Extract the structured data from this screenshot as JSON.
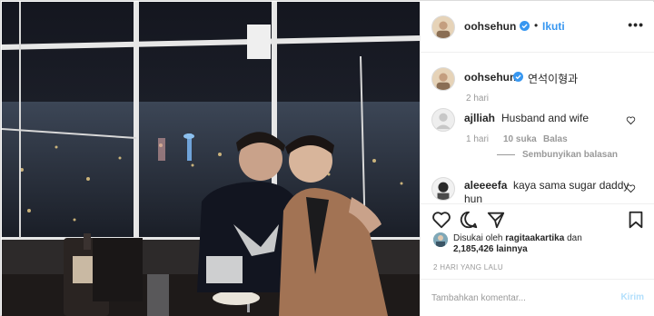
{
  "post": {
    "author": "oohsehun",
    "follow_label": "Ikuti",
    "separator": "•",
    "more_label": "•••",
    "photo_alt": "Two men sitting together at a restaurant table by a window at night with a city view"
  },
  "caption": {
    "user": "oohsehun",
    "text": "연석이형과",
    "time": "2 hari"
  },
  "comments": [
    {
      "user": "ajlliah",
      "text": "Husband and wife",
      "time": "1 hari",
      "likes": "10 suka",
      "reply_label": "Balas",
      "hide_replies_label": "Sembunyikan balasan"
    },
    {
      "user": "aleeeefa",
      "text": "kaya sama sugar daddy",
      "text_cont": "hun"
    }
  ],
  "likes": {
    "prefix": "Disukai oleh",
    "user": "ragitaakartika",
    "conj": "dan",
    "count": "2,185,426",
    "suffix": "lainnya"
  },
  "timestamp": "2 HARI YANG LALU",
  "add_comment": {
    "placeholder": "Tambahkan komentar...",
    "post_label": "Kirim"
  },
  "colors": {
    "link": "#3897f0",
    "muted": "#999999",
    "border": "#efefef",
    "verified": "#3897f0"
  }
}
